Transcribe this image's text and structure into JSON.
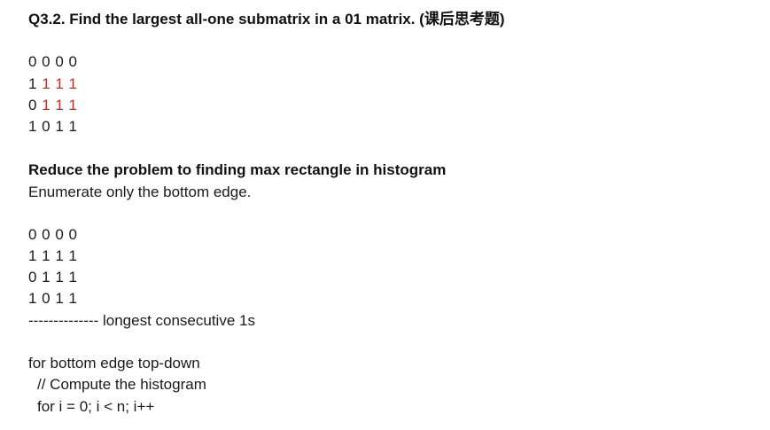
{
  "title": "Q3.2. Find the largest all-one submatrix in a 01 matrix. (课后思考题)",
  "matrix1": {
    "rows": [
      {
        "plain": "0 0 0 0",
        "red": ""
      },
      {
        "plain": "1 ",
        "red": "1 1 1"
      },
      {
        "plain": "0 ",
        "red": "1 1 1"
      },
      {
        "plain": "1 0 1 1",
        "red": ""
      }
    ],
    "highlight_color": "#e02020"
  },
  "section": {
    "heading": "Reduce the problem to finding max rectangle in histogram",
    "subtext": "Enumerate only the bottom edge."
  },
  "matrix2": {
    "rows": [
      "0 0 0 0",
      "1 1 1 1",
      "0 1 1 1",
      "1 0 1 1"
    ]
  },
  "divider_text": "-------------- longest consecutive 1s",
  "code": {
    "line1": "for bottom edge top-down",
    "line2": "// Compute the histogram",
    "line3": "for i = 0; i < n; i++"
  }
}
